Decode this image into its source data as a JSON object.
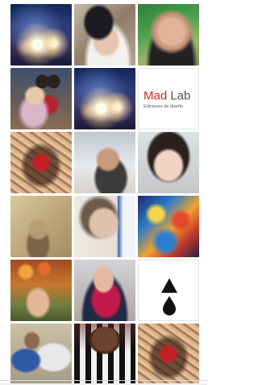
{
  "gallery": {
    "tiles": [
      {
        "kind": "photo",
        "subject": "fireworks"
      },
      {
        "kind": "photo",
        "subject": "woman"
      },
      {
        "kind": "photo",
        "subject": "man"
      },
      {
        "kind": "photo",
        "subject": "woman-with-mickey"
      },
      {
        "kind": "photo",
        "subject": "fireworks"
      },
      {
        "kind": "logo",
        "subject": "mad-lab"
      },
      {
        "kind": "art",
        "subject": "shield"
      },
      {
        "kind": "photo",
        "subject": "man-sunglasses"
      },
      {
        "kind": "photo",
        "subject": "woman"
      },
      {
        "kind": "photo",
        "subject": "vintage-pinup"
      },
      {
        "kind": "photo",
        "subject": "woman-sunglasses"
      },
      {
        "kind": "art",
        "subject": "painting"
      },
      {
        "kind": "photo",
        "subject": "lanterns-woman"
      },
      {
        "kind": "photo",
        "subject": "woman-scarf"
      },
      {
        "kind": "logo",
        "subject": "drop-triangle"
      },
      {
        "kind": "photo",
        "subject": "two-men"
      },
      {
        "kind": "photo",
        "subject": "footballer"
      },
      {
        "kind": "art",
        "subject": "shield"
      }
    ]
  },
  "madlab": {
    "title_part1": "Mad",
    "title_part2": "Lab",
    "subtitle": "Ediciones de diseño"
  },
  "colors": {
    "madlab_red": "#d6232a",
    "madlab_gray": "#555555",
    "drop_logo": "#111111"
  },
  "icons": {
    "drop_logo": "triangle-over-drop-icon"
  }
}
